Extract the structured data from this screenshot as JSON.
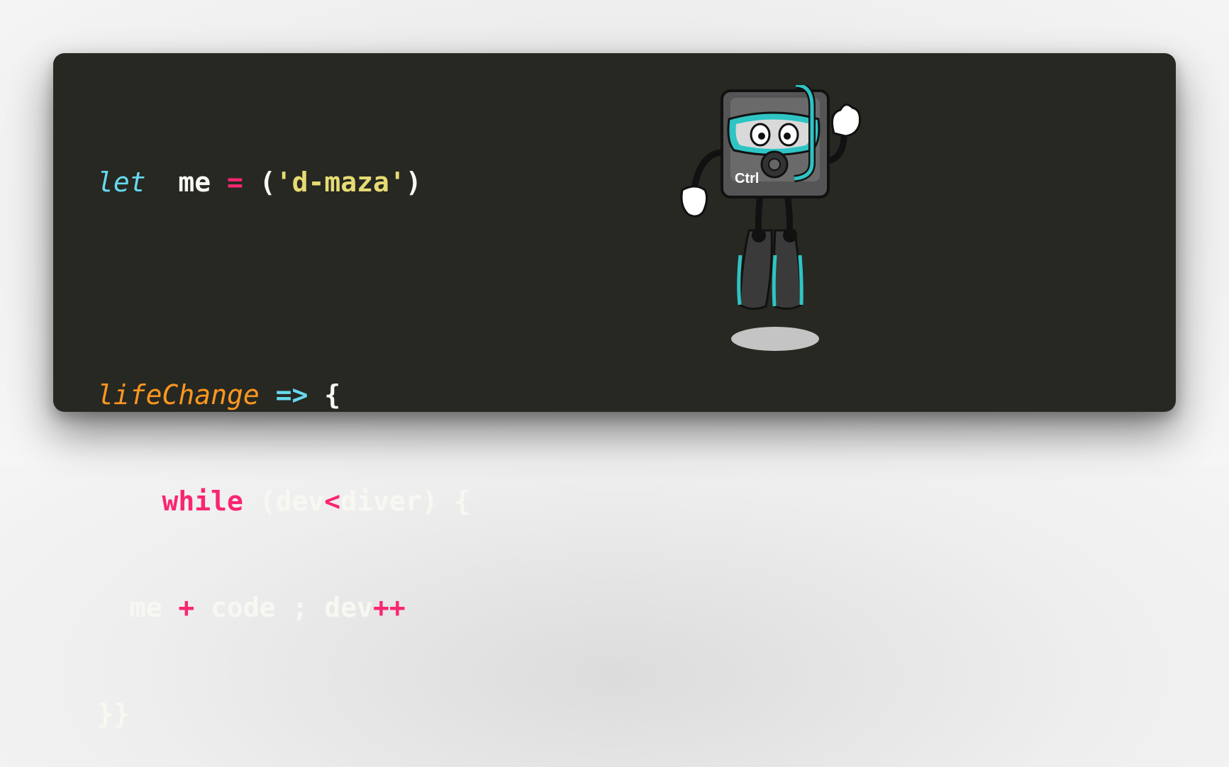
{
  "code": {
    "line1": {
      "kw": "let",
      "var": "  me ",
      "op": "=",
      "open": " (",
      "str": "'d-maza'",
      "close": ")"
    },
    "line3": {
      "fn": "lifeChange",
      "arrow": " =>",
      "brace": " {"
    },
    "line4": {
      "indent": "    ",
      "kw": "while",
      "pre": " (dev",
      "op": "<",
      "post": "diver) {"
    },
    "line5": {
      "pre": "  me ",
      "op1": "+",
      "mid": " code ; dev",
      "op2": "++"
    },
    "line6": {
      "text": "}}"
    }
  },
  "mascot": {
    "key_label": "Ctrl",
    "icon": "ctrl-key-diver-mascot"
  },
  "colors": {
    "background": "#272822",
    "keyword": "#66d9ef",
    "function": "#fd971f",
    "operator": "#f92672",
    "string": "#e6db74",
    "text": "#f8f8f2",
    "accent_teal": "#2ec4c4"
  }
}
